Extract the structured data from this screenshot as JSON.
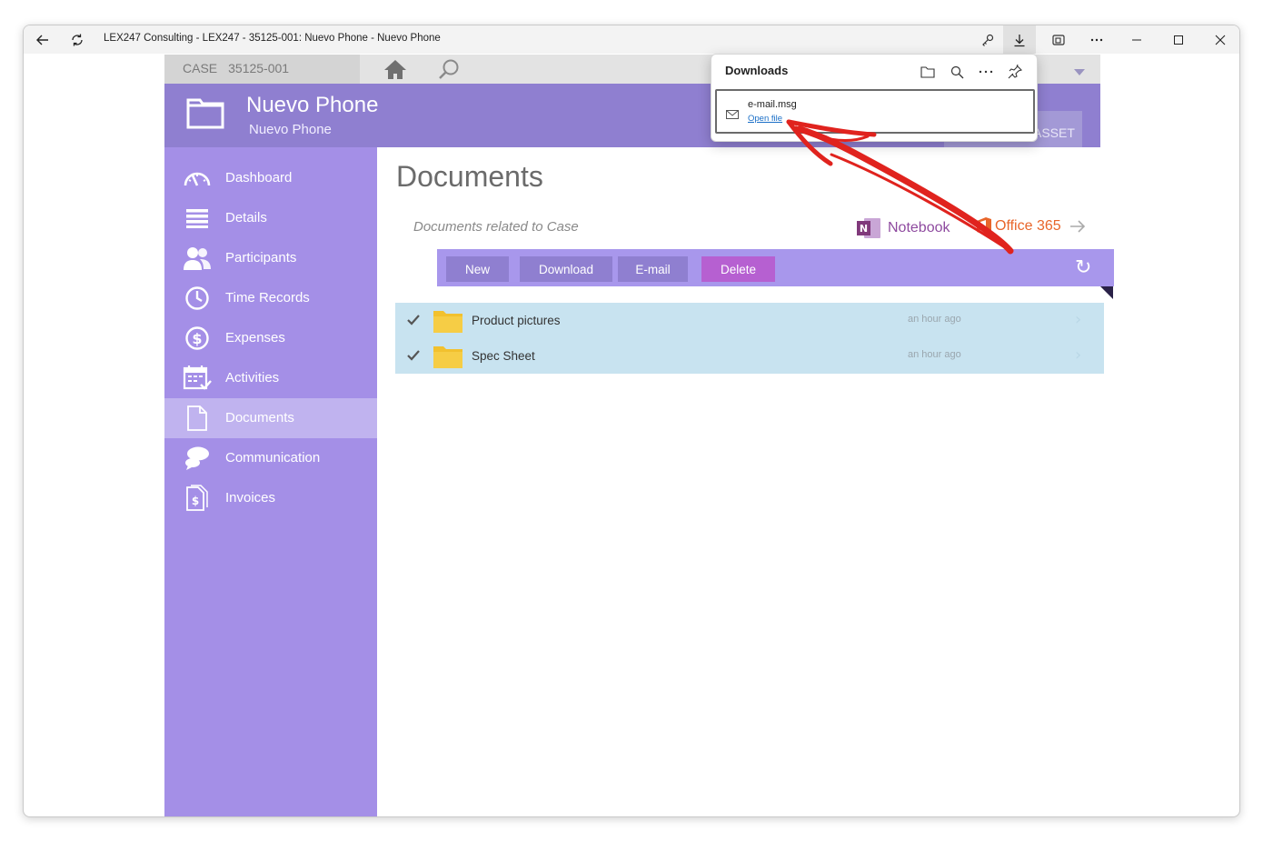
{
  "window": {
    "title": "LEX247 Consulting - LEX247 - 35125-001: Nuevo Phone - Nuevo Phone"
  },
  "casebar": {
    "label": "CASE",
    "number": "35125-001"
  },
  "header": {
    "title": "Nuevo Phone",
    "subtitle": "Nuevo Phone",
    "asset_button": "ASSET"
  },
  "sidebar": {
    "items": [
      {
        "label": "Dashboard",
        "icon": "gauge-icon"
      },
      {
        "label": "Details",
        "icon": "list-icon"
      },
      {
        "label": "Participants",
        "icon": "people-icon"
      },
      {
        "label": "Time Records",
        "icon": "clock-icon"
      },
      {
        "label": "Expenses",
        "icon": "dollar-icon"
      },
      {
        "label": "Activities",
        "icon": "calendar-icon"
      },
      {
        "label": "Documents",
        "icon": "document-icon",
        "active": true
      },
      {
        "label": "Communication",
        "icon": "chat-icon"
      },
      {
        "label": "Invoices",
        "icon": "invoice-icon"
      }
    ]
  },
  "main": {
    "title": "Documents",
    "subtitle": "Documents related to Case",
    "notebook_label": "Notebook",
    "office_label": "Office 365",
    "toolbar": {
      "new": "New",
      "download": "Download",
      "email": "E-mail",
      "delete": "Delete"
    },
    "rows": [
      {
        "name": "Product pictures",
        "time": "an hour ago"
      },
      {
        "name": "Spec Sheet",
        "time": "an hour ago"
      }
    ]
  },
  "downloads": {
    "title": "Downloads",
    "item": {
      "filename": "e-mail.msg",
      "action": "Open file"
    }
  },
  "colors": {
    "header": "#8f7fd0",
    "sidebar": "#a48fe7",
    "toolbar": "#a897ec",
    "delete": "#b660d1",
    "list": "#c8e3f0",
    "annotation": "#e0231e"
  }
}
